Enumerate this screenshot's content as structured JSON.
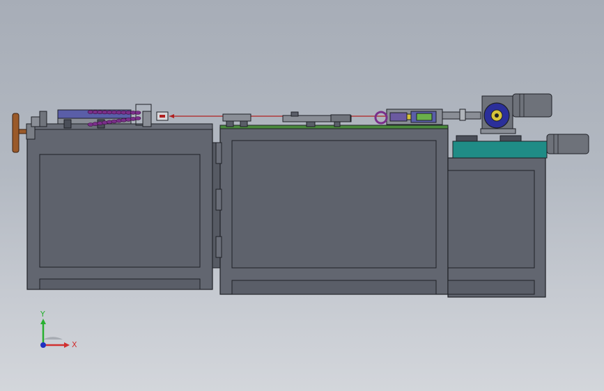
{
  "viewport": {
    "background_top": "#a7adb7",
    "background_bottom": "#d3d6db"
  },
  "machine": {
    "cabinet_color": "#626670",
    "cabinet_dark": "#4c4f57",
    "outline_color": "#1e2026",
    "top_plate_color": "#4a8a3c",
    "wire_color": "#b02020",
    "motor_color": "#6e727a",
    "gearbox_color": "#2b2f9a",
    "base_color": "#1f8c86",
    "chain_color": "#7a2f8a"
  },
  "triad": {
    "x_label": "X",
    "y_label": "Y",
    "x_color": "#d03030",
    "y_color": "#28b030",
    "z_color": "#2030c0"
  }
}
